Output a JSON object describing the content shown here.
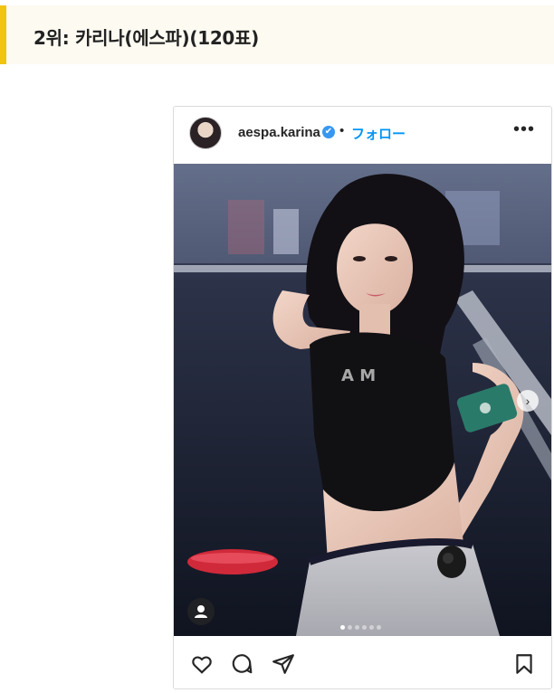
{
  "header": {
    "title": "2위: 카리나(에스파)(120표)"
  },
  "post": {
    "username": "aespa.karina",
    "verified_mark": "✔",
    "separator": "•",
    "follow_label": "フォロー",
    "more_label": "•••",
    "next_arrow": "›",
    "carousel_total": 6,
    "carousel_active": 0,
    "icons": [
      "heart-icon",
      "comment-icon",
      "share-icon",
      "bookmark-icon",
      "user-tag-icon"
    ]
  }
}
